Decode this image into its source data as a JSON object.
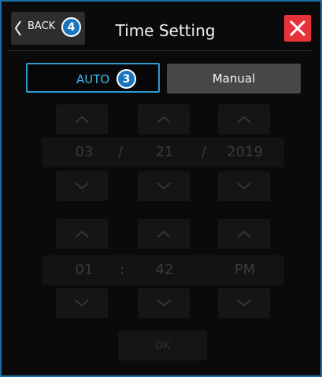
{
  "header": {
    "back_label": "BACK",
    "back_badge": "4",
    "title": "Time Setting",
    "close_icon": "close-icon"
  },
  "mode": {
    "auto_label": "AUTO",
    "auto_badge": "3",
    "manual_label": "Manual",
    "selected": "AUTO"
  },
  "date": {
    "month": "03",
    "separator1": "/",
    "day": "21",
    "separator2": "/",
    "year": "2019"
  },
  "time": {
    "hour": "01",
    "separator": ":",
    "minute": "42",
    "meridiem": "PM"
  },
  "footer": {
    "ok_label": "OK"
  },
  "colors": {
    "accent": "#2a9bd0",
    "close": "#e8323a",
    "badge": "#1a75c0",
    "frame": "#1b6fa6"
  }
}
